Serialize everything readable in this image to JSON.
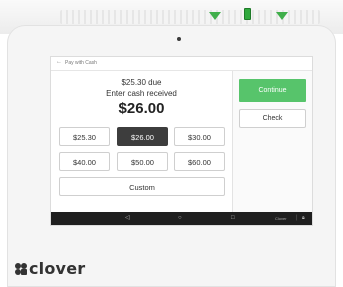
{
  "header": {
    "title": "Pay with Cash"
  },
  "summary": {
    "due": "$25.30 due",
    "prompt": "Enter cash received",
    "amount": "$26.00"
  },
  "cash_options": [
    {
      "label": "$25.30",
      "selected": false
    },
    {
      "label": "$26.00",
      "selected": true
    },
    {
      "label": "$30.00",
      "selected": false
    },
    {
      "label": "$40.00",
      "selected": false
    },
    {
      "label": "$50.00",
      "selected": false
    },
    {
      "label": "$60.00",
      "selected": false
    }
  ],
  "custom_label": "Custom",
  "actions": {
    "continue_label": "Continue",
    "check_label": "Check"
  },
  "navbar": {
    "status_text": "Clover"
  },
  "brand": {
    "name": "clover"
  },
  "colors": {
    "accent": "#57c46b",
    "selected": "#3d3d3d",
    "led": "#2fa83c"
  }
}
